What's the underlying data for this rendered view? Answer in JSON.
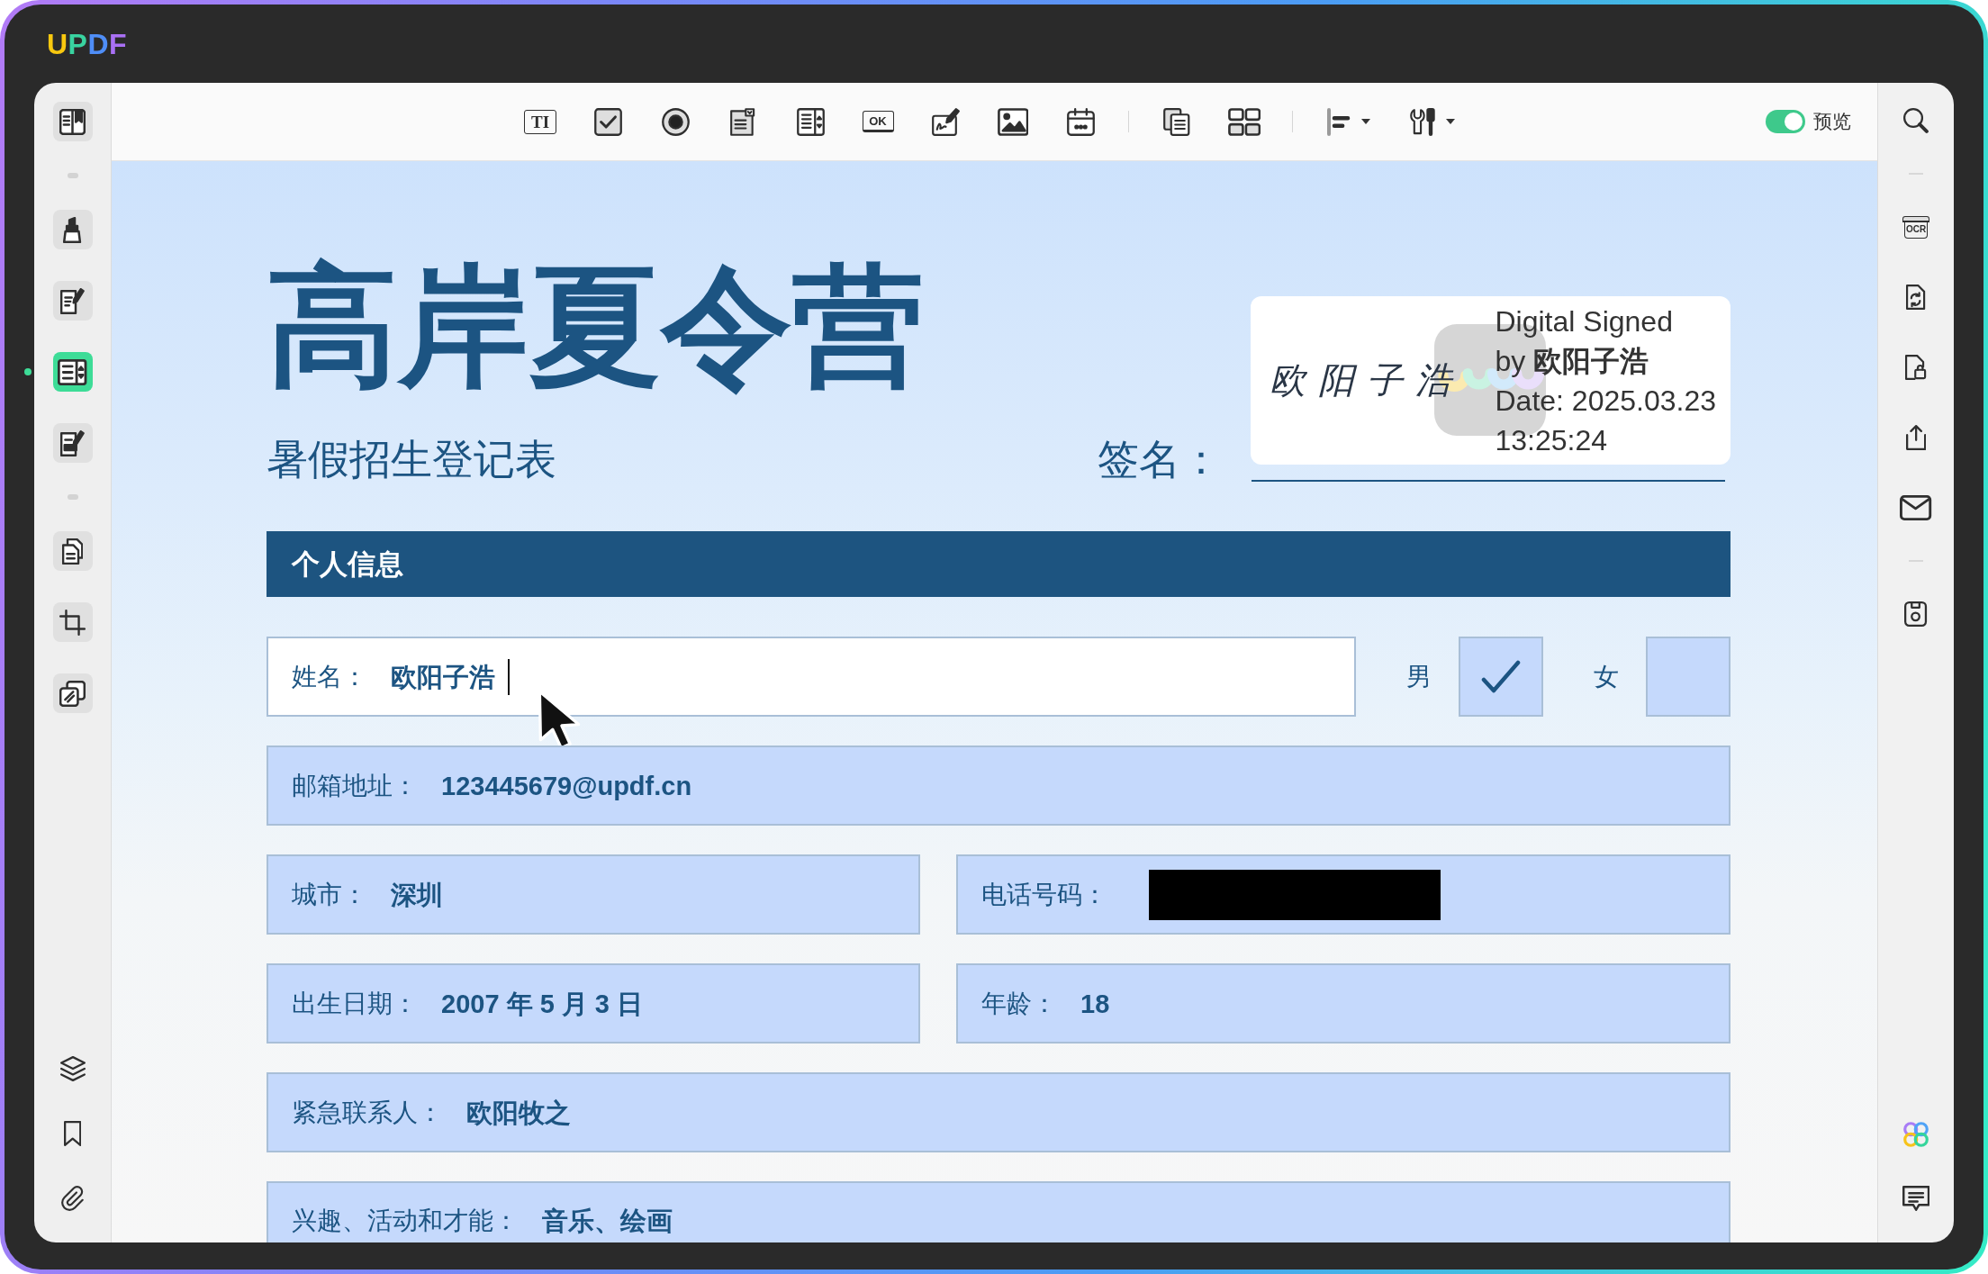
{
  "app": {
    "logo": "UPDF"
  },
  "left_sidebar": {
    "groups": [
      {
        "items": [
          {
            "kind": "reader",
            "selected": false
          }
        ]
      },
      {
        "items": [
          {
            "kind": "highlighter",
            "selected": false
          },
          {
            "kind": "edit",
            "selected": false
          },
          {
            "kind": "form",
            "selected": true
          },
          {
            "kind": "sign",
            "selected": false
          }
        ]
      },
      {
        "items": [
          {
            "kind": "organize",
            "selected": false
          },
          {
            "kind": "crop",
            "selected": false
          },
          {
            "kind": "combine",
            "selected": false
          }
        ]
      }
    ],
    "bottom_items": [
      {
        "kind": "layers"
      },
      {
        "kind": "bookmark"
      },
      {
        "kind": "attachment"
      }
    ]
  },
  "toolbar": {
    "groups": [
      {
        "tools": [
          {
            "kind": "text-field",
            "glyph": "TI",
            "dropdown": false
          },
          {
            "kind": "checkbox",
            "dropdown": false
          },
          {
            "kind": "radio",
            "dropdown": false
          },
          {
            "kind": "combo-box",
            "dropdown": false
          },
          {
            "kind": "list-box",
            "dropdown": false
          },
          {
            "kind": "push-button",
            "glyph": "OK",
            "dropdown": false
          },
          {
            "kind": "signature",
            "dropdown": false
          },
          {
            "kind": "image",
            "dropdown": false
          },
          {
            "kind": "date",
            "dropdown": false
          }
        ]
      },
      {
        "tools": [
          {
            "kind": "duplicate",
            "dropdown": false
          },
          {
            "kind": "grid",
            "dropdown": false
          }
        ]
      },
      {
        "tools": [
          {
            "kind": "align",
            "dropdown": true
          },
          {
            "kind": "tools",
            "dropdown": true
          }
        ]
      }
    ],
    "preview_toggle": {
      "label": "预览",
      "on": true
    }
  },
  "right_sidebar": {
    "groups": [
      {
        "items": [
          {
            "kind": "search"
          }
        ]
      },
      {
        "items": [
          {
            "kind": "ocr",
            "glyph": "OCR"
          },
          {
            "kind": "convert"
          },
          {
            "kind": "protect"
          },
          {
            "kind": "share"
          },
          {
            "kind": "email"
          }
        ]
      },
      {
        "items": [
          {
            "kind": "save"
          }
        ]
      }
    ],
    "bottom_items": [
      {
        "kind": "ai"
      },
      {
        "kind": "comment"
      }
    ]
  },
  "document": {
    "title": "高岸夏令营",
    "subtitle": "暑假招生登记表",
    "signature": {
      "label": "签名：",
      "handwriting": "欧阳子浩",
      "lines": [
        "Digital Signed",
        "by **欧阳子浩**",
        "Date: 2025.03.23",
        "13:25:24"
      ]
    },
    "section_title": "个人信息",
    "rows": [
      {
        "fields": [
          {
            "label": "姓名：",
            "value": "欧阳子浩",
            "focused": true,
            "redacted": false
          }
        ],
        "options": [
          {
            "label": "男",
            "checked": true
          },
          {
            "label": "女",
            "checked": false
          }
        ]
      },
      {
        "fields": [
          {
            "label": "邮箱地址：",
            "value": "123445679@updf.cn",
            "focused": false,
            "redacted": false
          }
        ]
      },
      {
        "fields": [
          {
            "label": "城市：",
            "value": "深圳",
            "focused": false,
            "redacted": false
          },
          {
            "label": "电话号码：",
            "focused": false,
            "redacted": true
          }
        ]
      },
      {
        "fields": [
          {
            "label": "出生日期：",
            "value": "2007 年 5 月 3 日",
            "focused": false,
            "redacted": false
          },
          {
            "label": "年龄：",
            "value": "18",
            "focused": false,
            "redacted": false
          }
        ]
      },
      {
        "fields": [
          {
            "label": "紧急联系人：",
            "value": "欧阳牧之",
            "focused": false,
            "redacted": false
          }
        ]
      },
      {
        "fields": [
          {
            "label": "兴趣、活动和才能：",
            "value": "音乐、绘画",
            "focused": false,
            "redacted": false
          }
        ]
      }
    ]
  }
}
